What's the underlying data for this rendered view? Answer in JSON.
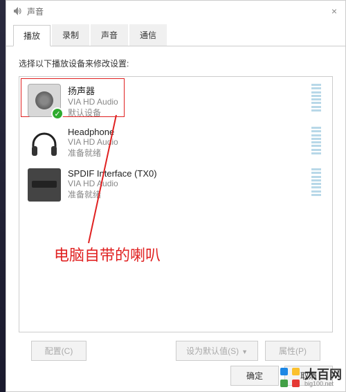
{
  "title": "声音",
  "tabs": [
    "播放",
    "录制",
    "声音",
    "通信"
  ],
  "active_tab": 0,
  "instruction": "选择以下播放设备来修改设置:",
  "devices": [
    {
      "name": "扬声器",
      "driver": "VIA HD Audio",
      "status": "默认设备",
      "default": true,
      "highlighted": true
    },
    {
      "name": "Headphone",
      "driver": "VIA HD Audio",
      "status": "准备就绪",
      "default": false,
      "highlighted": false
    },
    {
      "name": "SPDIF Interface (TX0)",
      "driver": "VIA HD Audio",
      "status": "准备就绪",
      "default": false,
      "highlighted": false
    }
  ],
  "buttons": {
    "configure": "配置(C)",
    "set_default": "设为默认值(S)",
    "properties": "属性(P)",
    "ok": "确定",
    "cancel": "取消"
  },
  "annotation": "电脑自带的喇叭",
  "watermark": {
    "name": "大百网",
    "url": "big100.net"
  }
}
